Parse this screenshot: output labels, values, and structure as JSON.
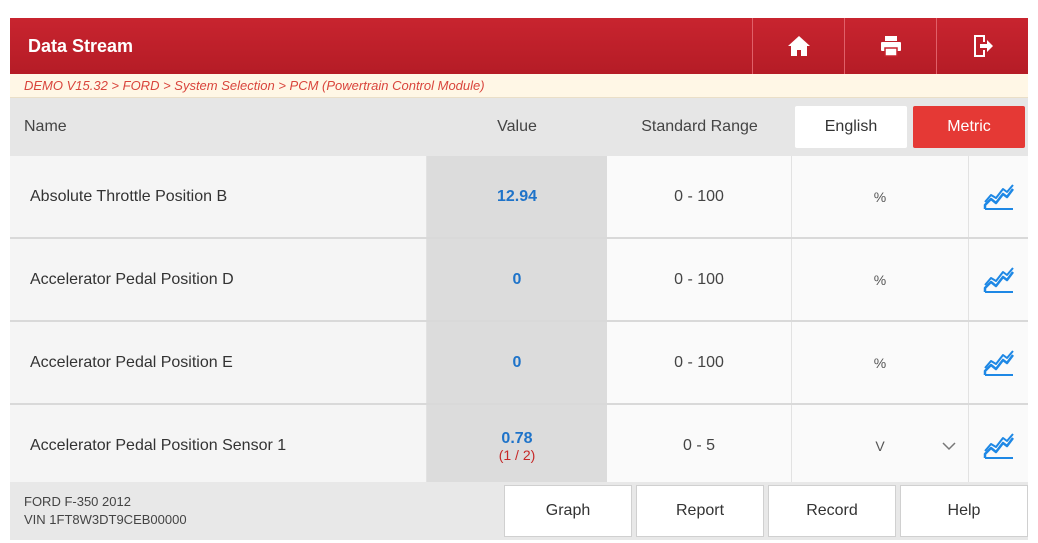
{
  "header": {
    "title": "Data Stream",
    "buttons": [
      {
        "icon": "home-icon"
      },
      {
        "icon": "printer-icon"
      },
      {
        "icon": "exit-icon"
      }
    ]
  },
  "breadcrumb": "DEMO V15.32 > FORD > System Selection > PCM (Powertrain Control Module)",
  "table": {
    "columns": {
      "name": "Name",
      "value": "Value",
      "range": "Standard Range"
    },
    "unit_toggle": {
      "english": "English",
      "metric": "Metric",
      "selected": "Metric"
    },
    "rows": [
      {
        "name": "Absolute Throttle Position B",
        "value": "12.94",
        "sub": "",
        "range": "0 - 100",
        "unit": "%",
        "dropdown": false
      },
      {
        "name": "Accelerator Pedal Position D",
        "value": "0",
        "sub": "",
        "range": "0 - 100",
        "unit": "%",
        "dropdown": false
      },
      {
        "name": "Accelerator Pedal Position E",
        "value": "0",
        "sub": "",
        "range": "0 - 100",
        "unit": "%",
        "dropdown": false
      },
      {
        "name": "Accelerator Pedal Position Sensor 1",
        "value": "0.78",
        "sub": "(1 / 2)",
        "range": "0 - 5",
        "unit": "V",
        "dropdown": true
      }
    ]
  },
  "footer": {
    "vehicle": "FORD F-350 2012",
    "vin": "VIN 1FT8W3DT9CEB00000",
    "buttons": {
      "graph": "Graph",
      "report": "Report",
      "record": "Record",
      "help": "Help"
    }
  },
  "colors": {
    "header": "#c8242f",
    "breadcrumb_text": "#d9453c",
    "value_text": "#1e73c9",
    "sub_text": "#c62828",
    "metric_active": "#e53935",
    "graph_icon": "#1e88e5"
  }
}
